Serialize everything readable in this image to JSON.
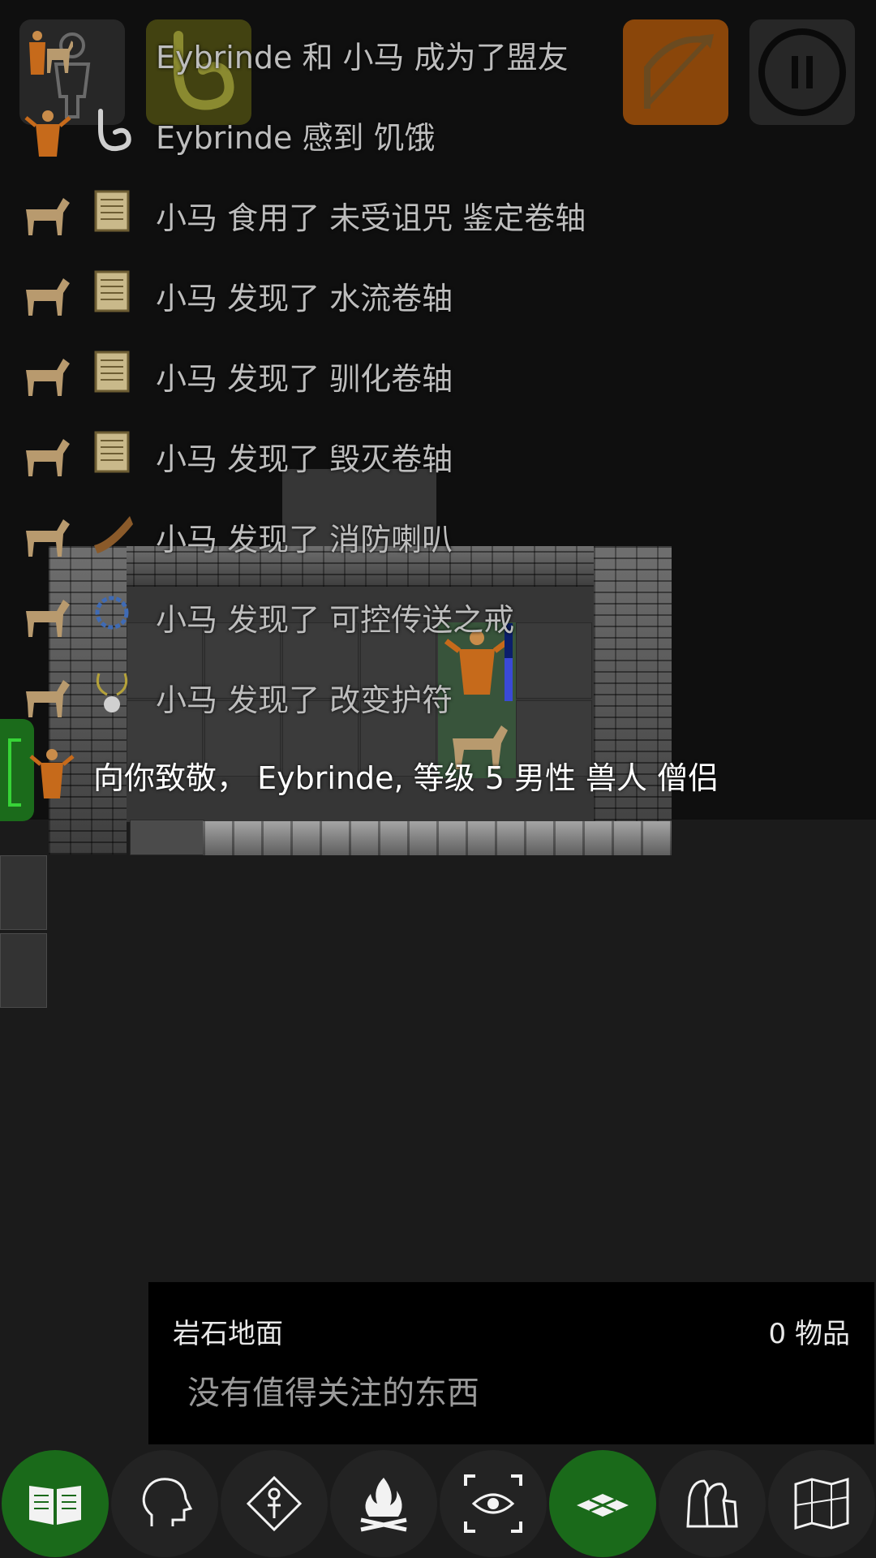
{
  "log": {
    "messages": [
      {
        "subject_icon": "monk-and-pony-icon",
        "object_icon": "",
        "text": "Eybrinde 和 小马 成为了盟友"
      },
      {
        "subject_icon": "monk-icon",
        "object_icon": "stomach-icon",
        "text": "Eybrinde 感到 饥饿"
      },
      {
        "subject_icon": "pony-icon",
        "object_icon": "scroll-icon",
        "text": "小马 食用了 未受诅咒 鉴定卷轴"
      },
      {
        "subject_icon": "pony-icon",
        "object_icon": "scroll-icon",
        "text": "小马 发现了 水流卷轴"
      },
      {
        "subject_icon": "pony-icon",
        "object_icon": "scroll-icon",
        "text": "小马 发现了 驯化卷轴"
      },
      {
        "subject_icon": "pony-icon",
        "object_icon": "scroll-icon",
        "text": "小马 发现了 毁灭卷轴"
      },
      {
        "subject_icon": "pony-icon",
        "object_icon": "horn-icon",
        "text": "小马 发现了 消防喇叭"
      },
      {
        "subject_icon": "pony-icon",
        "object_icon": "ring-icon",
        "text": "小马 发现了 可控传送之戒"
      },
      {
        "subject_icon": "pony-icon",
        "object_icon": "amulet-icon",
        "text": "小马 发现了 改变护符"
      }
    ],
    "greeting": {
      "subject_icon": "monk-icon",
      "text": "向你致敬， Eybrinde, 等级 5 男性 兽人 僧侣"
    }
  },
  "hud": {
    "character_icon": "character-silhouette-icon",
    "hunger_icon": "stomach-icon",
    "ranged_icon": "bow-arrow-icon",
    "pause_icon": "pause-icon",
    "hunger_color": "#6e6e14",
    "ranged_color": "#b45a0a"
  },
  "map": {
    "player_hp_fraction": 0.55
  },
  "tile_info": {
    "name": "岩石地面",
    "item_count": "0 物品",
    "description": "没有值得关注的东西"
  },
  "toolbar": {
    "buttons": [
      {
        "icon": "book-icon",
        "active": true
      },
      {
        "icon": "head-icon",
        "active": false
      },
      {
        "icon": "ankh-diamond-icon",
        "active": false
      },
      {
        "icon": "campfire-icon",
        "active": false
      },
      {
        "icon": "eye-expand-icon",
        "active": false
      },
      {
        "icon": "floor-tiles-icon",
        "active": true
      },
      {
        "icon": "inventory-bags-icon",
        "active": false
      },
      {
        "icon": "map-icon",
        "active": false
      }
    ],
    "accent_color": "#1a6a1a"
  }
}
